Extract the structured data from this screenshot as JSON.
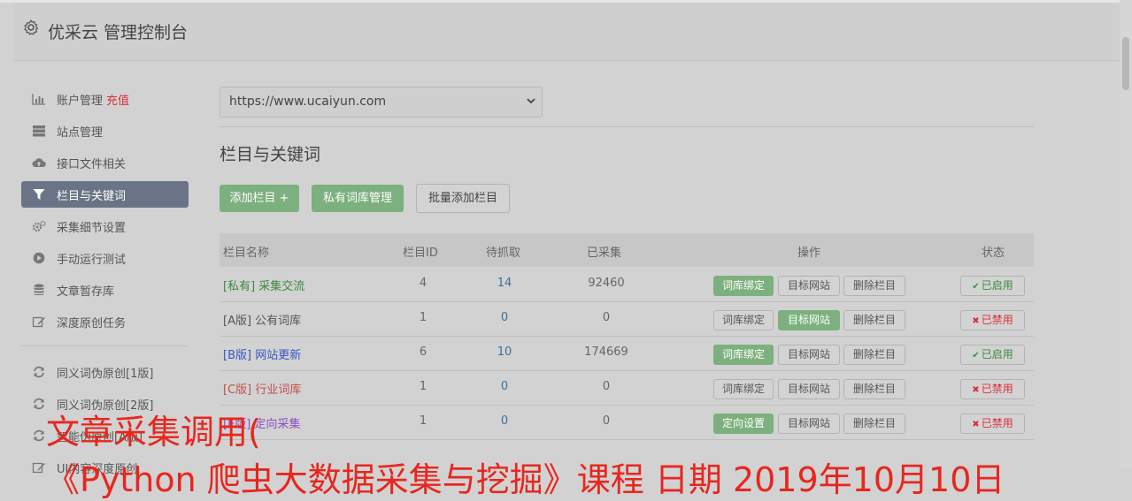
{
  "header": {
    "title": "优采云 管理控制台",
    "icon": "gear-icon"
  },
  "sidebar": {
    "items": [
      {
        "label": "账户管理",
        "extra": "充值",
        "icon": "bar-chart-icon"
      },
      {
        "label": "站点管理",
        "icon": "server-icon"
      },
      {
        "label": "接口文件相关",
        "icon": "cloud-upload-icon"
      },
      {
        "label": "栏目与关键词",
        "icon": "filter-icon",
        "active": true
      },
      {
        "label": "采集细节设置",
        "icon": "cogs-icon"
      },
      {
        "label": "手动运行测试",
        "icon": "play-circle-icon"
      },
      {
        "label": "文章暂存库",
        "icon": "database-icon"
      },
      {
        "label": "深度原创任务",
        "icon": "edit-icon"
      },
      {
        "label": "同义词伪原创[1版]",
        "icon": "refresh-icon"
      },
      {
        "label": "同义词伪原创[2版]",
        "icon": "refresh-icon"
      },
      {
        "label": "智能伪原创[A版]",
        "icon": "refresh-icon"
      },
      {
        "label": "UI内容深度原创",
        "icon": "edit-icon"
      }
    ]
  },
  "site_select": {
    "value": "https://www.ucaiyun.com"
  },
  "section_title": "栏目与关键词",
  "toolbar": {
    "add_column": "添加栏目 +",
    "private_lexicon": "私有词库管理",
    "batch_add": "批量添加栏目"
  },
  "table": {
    "headers": [
      "栏目名称",
      "栏目ID",
      "待抓取",
      "已采集",
      "操作",
      "状态"
    ],
    "rows": [
      {
        "name": "[私有] 采集交流",
        "name_color": "#3d8a3e",
        "id": "4",
        "pending": "14",
        "collected": "92460",
        "actions": [
          "词库绑定",
          "目标网站",
          "删除栏目"
        ],
        "highlight": 0,
        "status": "已启用",
        "status_on": true
      },
      {
        "name": "[A版] 公有词库",
        "name_color": "#555555",
        "id": "1",
        "pending": "0",
        "collected": "0",
        "actions": [
          "词库绑定",
          "目标网站",
          "删除栏目"
        ],
        "highlight": 1,
        "status": "已禁用",
        "status_on": false
      },
      {
        "name": "[B版] 网站更新",
        "name_color": "#3a55c4",
        "id": "6",
        "pending": "10",
        "collected": "174669",
        "actions": [
          "词库绑定",
          "目标网站",
          "删除栏目"
        ],
        "highlight": 0,
        "status": "已启用",
        "status_on": true
      },
      {
        "name": "[C版] 行业词库",
        "name_color": "#c0504d",
        "id": "1",
        "pending": "0",
        "collected": "0",
        "actions": [
          "词库绑定",
          "目标网站",
          "删除栏目"
        ],
        "highlight": -1,
        "status": "已禁用",
        "status_on": false
      },
      {
        "name": "[E版] 定向采集",
        "name_color": "#8a4fc4",
        "id": "1",
        "pending": "0",
        "collected": "0",
        "actions": [
          "定向设置",
          "目标网站",
          "删除栏目"
        ],
        "highlight": 0,
        "status": "已禁用",
        "status_on": false
      }
    ]
  },
  "overlay": {
    "line1": "文章采集调用(",
    "line2": "《Python 爬虫大数据采集与挖掘》课程 日期 2019年10月10日"
  }
}
